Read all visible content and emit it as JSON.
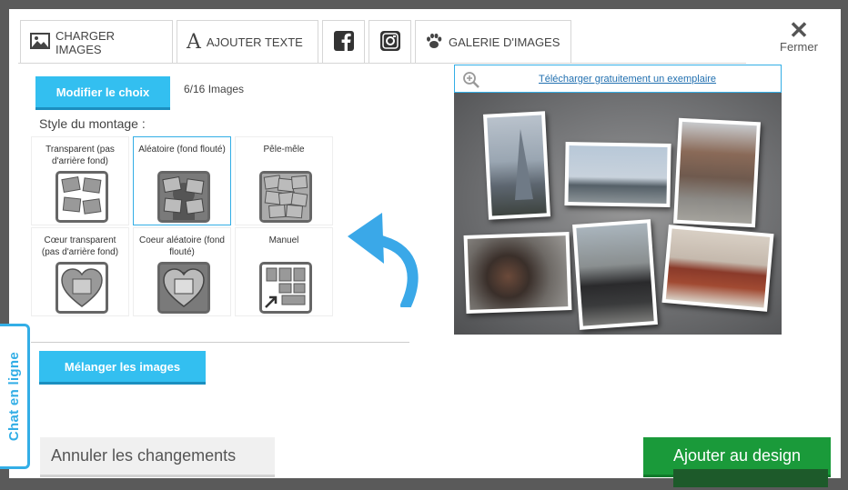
{
  "tabs": [
    {
      "label": "CHARGER IMAGES",
      "icon": "image-icon"
    },
    {
      "label": "AJOUTER TEXTE",
      "icon": "text-icon"
    },
    {
      "label": "",
      "icon": "facebook-icon"
    },
    {
      "label": "",
      "icon": "instagram-icon"
    },
    {
      "label": "GALERIE D'IMAGES",
      "icon": "paw-icon"
    }
  ],
  "close": {
    "label": "Fermer",
    "icon": "close-icon"
  },
  "toolbar": {
    "modify_label": "Modifier le choix",
    "count": "6/16 Images"
  },
  "style_section": {
    "title": "Style du montage :",
    "options": [
      {
        "label": "Transparent (pas d'arrière fond)",
        "selected": false
      },
      {
        "label": "Aléatoire (fond flouté)",
        "selected": true
      },
      {
        "label": "Pêle-mêle",
        "selected": false
      },
      {
        "label": "Cœur transparent (pas d'arrière fond)",
        "selected": false
      },
      {
        "label": "Coeur aléatoire (fond flouté)",
        "selected": false
      },
      {
        "label": "Manuel",
        "selected": false
      }
    ]
  },
  "shuffle_label": "Mélanger les images",
  "preview": {
    "download_link": "Télécharger gratuitement un exemplaire",
    "icon": "zoom-in-icon"
  },
  "chat_label": "Chat en ligne",
  "footer": {
    "cancel_label": "Annuler les changements",
    "add_label": "Ajouter au design"
  },
  "colors": {
    "accent": "#33bff0",
    "primary": "#1a9a3a",
    "link": "#2270b0"
  }
}
